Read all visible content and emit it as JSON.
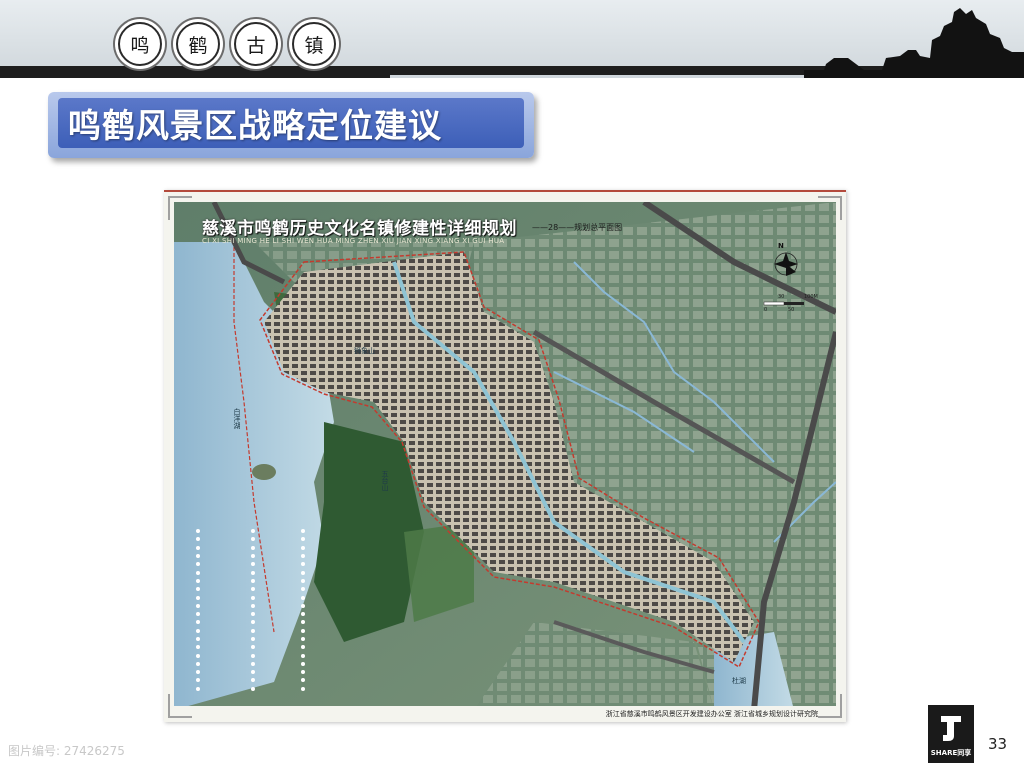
{
  "header": {
    "badges": [
      "鸣",
      "鹤",
      "古",
      "镇"
    ]
  },
  "slide": {
    "title": "鸣鹤风景区战略定位建议",
    "page_number": "33"
  },
  "map": {
    "title": "慈溪市鸣鹤历史文化名镇修建性详细规划",
    "pinyin": "CI XI SHI MING HE LI SHI WEN HUA MING ZHEN XIU JIAN XING XIANG XI GUI HUA",
    "subtitle": "——28——规划总平面图",
    "north_label": "N",
    "scale": {
      "a": "30",
      "b": "100M",
      "c": "0",
      "d": "50"
    },
    "footer": "浙江省慈溪市鸣鹤风景区开发建设办公室  浙江省城乡规划设计研究院",
    "places": {
      "lake_west": "白洋湖",
      "hill_north": "狮象山",
      "hill_south": "五台山",
      "lake_south": "杜湖"
    }
  },
  "logo": {
    "text": "SHARE同享"
  },
  "watermark": "图片编号: 27426275"
}
